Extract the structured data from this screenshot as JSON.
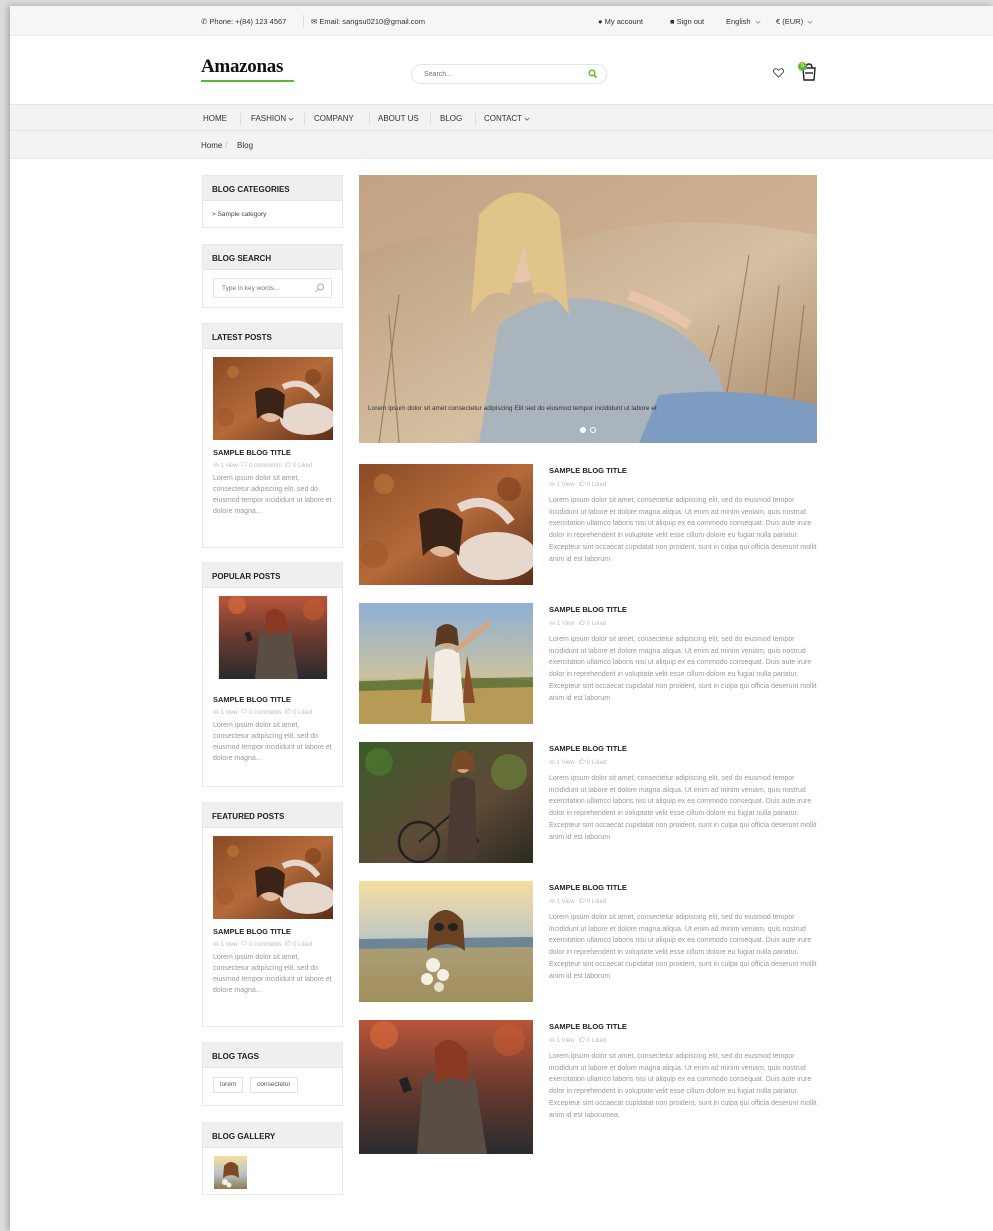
{
  "topbar": {
    "phone": "Phone: +(84) 123 4567",
    "email": "Email: sangsu0210@gmail.com",
    "my_account": "My account",
    "sign_out": "Sign out",
    "language": "English",
    "currency": "€ (EUR)"
  },
  "header": {
    "logo": "Amazonas",
    "search_placeholder": "Search...",
    "cart_count": "0"
  },
  "nav": {
    "items": [
      "HOME",
      "FASHION",
      "COMPANY",
      "ABOUT US",
      "BLOG",
      "CONTACT"
    ]
  },
  "breadcrumb": {
    "home": "Home",
    "separator": "/",
    "current": "Blog"
  },
  "sidebar": {
    "categories": {
      "title": "BLOG CATEGORIES",
      "items": [
        "> Sample category"
      ]
    },
    "search": {
      "title": "BLOG SEARCH",
      "placeholder": "Type in key words..."
    },
    "latest": {
      "title": "LATEST POSTS",
      "post_title": "SAMPLE BLOG TITLE",
      "meta_views": "1 view",
      "meta_comments": "0 comments",
      "meta_likes": "0 Liked",
      "excerpt": "Lorem ipsum dolor sit amet, consectetur adipiscing elit, sed do eiusmod tempor incididunt ut labore et dolore magna..."
    },
    "popular": {
      "title": "POPULAR POSTS",
      "post_title": "SAMPLE BLOG TITLE",
      "meta_views": "1 view",
      "meta_comments": "0 comments",
      "meta_likes": "0 Liked",
      "excerpt": "Lorem ipsum dolor sit amet, consectetur adipiscing elit, sed do eiusmod tempor incididunt ut labore et dolore magna..."
    },
    "featured": {
      "title": "FEATURED POSTS",
      "post_title": "SAMPLE BLOG TITLE",
      "meta_views": "1 view",
      "meta_comments": "0 comments",
      "meta_likes": "0 Liked",
      "excerpt": "Lorem ipsum dolor sit amet, consectetur adipiscing elit, sed do eiusmod tempor incididunt ut labore et dolore magna..."
    },
    "tags": {
      "title": "BLOG TAGS",
      "items": [
        "lorem",
        "consectetur"
      ]
    },
    "gallery": {
      "title": "BLOG GALLERY"
    }
  },
  "slider": {
    "caption": "Lorem ipsum dolor sit amet consectetur adipiscing Elit sed do eiusmod tempor incididunt ut labore et"
  },
  "posts": [
    {
      "title": "SAMPLE BLOG TITLE",
      "views": "1 View",
      "likes": "0 Liked",
      "excerpt": "Lorem ipsum dolor sit amet, consectetur adipiscing elit, sed do eiusmod tempor incididunt ut labore et dolore magna aliqua. Ut enim ad minim veniam, quis nostrud exercitation ullamco laboris nisi ut aliquip ex ea commodo consequat. Duis aute irure dolor in reprehenderit in voluptate velit esse cillum dolore eu fugiat nulla pariatur. Excepteur sint occaecat cupidatat non proident, sunt in culpa qui officia deserunt mollit anim id est laborum"
    },
    {
      "title": "SAMPLE BLOG TITLE",
      "views": "1 View",
      "likes": "0 Liked",
      "excerpt": "Lorem ipsum dolor sit amet, consectetur adipiscing elit, sed do eiusmod tempor incididunt ut labore et dolore magna aliqua. Ut enim ad minim veniam, quis nostrud exercitation ullamco laboris nisi ut aliquip ex ea commodo consequat. Duis aute irure dolor in reprehenderit in voluptate velit esse cillum dolore eu fugiat nulla pariatur. Excepteur sint occaecat cupidatat non proident, sunt in culpa qui officia deserunt mollit anim id est laborum"
    },
    {
      "title": "SAMPLE BLOG TITLE",
      "views": "1 View",
      "likes": "0 Liked",
      "excerpt": "Lorem ipsum dolor sit amet, consectetur adipiscing elit, sed do eiusmod tempor incididunt ut labore et dolore magna aliqua. Ut enim ad minim veniam, quis nostrud exercitation ullamco laboris nisi ut aliquip ex ea commodo consequat. Duis aute irure dolor in reprehenderit in voluptate velit esse cillum dolore eu fugiat nulla pariatur. Excepteur sint occaecat cupidatat non proident, sunt in culpa qui officia deserunt mollit anim id est laborum"
    },
    {
      "title": "SAMPLE BLOG TITLE",
      "views": "1 View",
      "likes": "0 Liked",
      "excerpt": "Lorem ipsum dolor sit amet, consectetur adipiscing elit, sed do eiusmod tempor incididunt ut labore et dolore magna aliqua. Ut enim ad minim veniam, quis nostrud exercitation ullamco laboris nisi ut aliquip ex ea commodo consequat. Duis aute irure dolor in reprehenderit in voluptate velit esse cillum dolore eu fugiat nulla pariatur. Excepteur sint occaecat cupidatat non proident, sunt in culpa qui officia deserunt mollit anim id est laborum"
    },
    {
      "title": "SAMPLE BLOG TITLE",
      "views": "1 View",
      "likes": "0 Liked",
      "excerpt": "Lorem ipsum dolor sit amet, consectetur adipiscing elit, sed do eiusmod tempor incididunt ut labore et dolore magna aliqua. Ut enim ad minim veniam, quis nostrud exercitation ullamco laboris nisi ut aliquip ex ea commodo consequat. Duis aute irure dolor in reprehenderit in voluptate velit esse cillum dolore eu fugiat nulla pariatur. Excepteur sint occaecat cupidatat non proident, sunt in culpa qui officia deserunt mollit anim id est laborumea."
    }
  ],
  "colors": {
    "accent": "#5cb82e",
    "panel": "#efefef",
    "muted_text": "#999999"
  },
  "icons": [
    "phone-icon",
    "envelope-icon",
    "user-icon",
    "lock-icon",
    "chevron-down-icon",
    "search-icon",
    "heart-icon",
    "cart-icon",
    "eye-icon",
    "comment-icon",
    "thumb-icon"
  ]
}
